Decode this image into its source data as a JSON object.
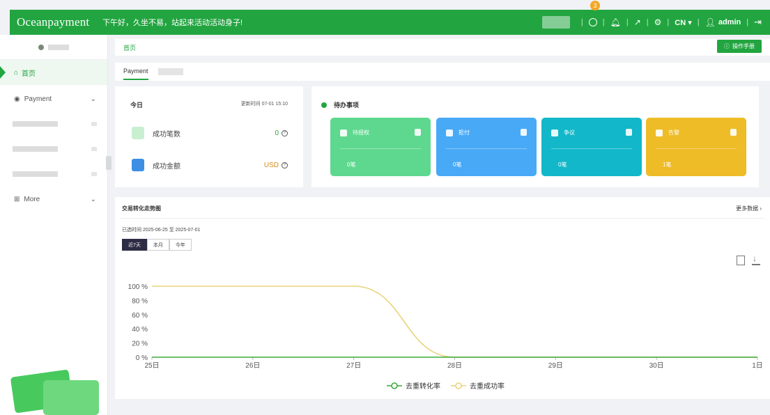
{
  "topbar": {
    "logo": "Oceanpayment",
    "greeting": "下午好，久坐不易，站起来活动活动身子!",
    "notification_count": "3",
    "language": "CN ▾",
    "user": "admin"
  },
  "sidebar": {
    "items": [
      {
        "label": "首页"
      },
      {
        "label": "Payment"
      },
      {
        "label": "More"
      }
    ]
  },
  "breadcrumb": {
    "home": "首页"
  },
  "manual_button": "操作手册",
  "tabs": {
    "active": "Payment"
  },
  "today": {
    "title": "今日",
    "updated": "更新时间 07-01 15:10",
    "rows": [
      {
        "label": "成功笔数",
        "value": "0"
      },
      {
        "label": "成功金额",
        "value": "USD"
      }
    ]
  },
  "todo": {
    "title": "待办事项",
    "cards": [
      {
        "label": "待授权",
        "count": "0笔",
        "color": "#5ed88f"
      },
      {
        "label": "拒付",
        "count": "0笔",
        "color": "#48a9f7"
      },
      {
        "label": "争议",
        "count": "0笔",
        "color": "#12b8c9"
      },
      {
        "label": "告警",
        "count": "1笔",
        "color": "#eebc27"
      }
    ]
  },
  "trend": {
    "title": "交易转化走势图",
    "more": "更多数据 ›",
    "range_text": "已选时间 2025-06-25 至 2025-07-01",
    "range_buttons": [
      "近7天",
      "本月",
      "今年"
    ]
  },
  "chart_data": {
    "type": "line",
    "categories": [
      "25日",
      "26日",
      "27日",
      "28日",
      "29日",
      "30日",
      "1日"
    ],
    "y_ticks": [
      "0 %",
      "20 %",
      "40 %",
      "60 %",
      "80 %",
      "100 %"
    ],
    "ylim": [
      0,
      100
    ],
    "series": [
      {
        "name": "去重转化率",
        "values": [
          0,
          0,
          0,
          0,
          0,
          0,
          0
        ],
        "color": "#3aa83a"
      },
      {
        "name": "去重成功率",
        "values": [
          100,
          100,
          100,
          0,
          0,
          0,
          0
        ],
        "color": "#ead27a"
      }
    ],
    "legend": "bottom"
  }
}
